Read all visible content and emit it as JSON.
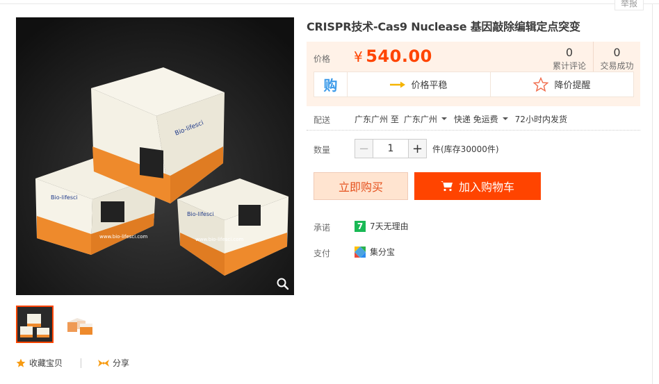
{
  "header": {
    "report_label": "举报"
  },
  "product": {
    "title": "CRISPR技术-Cas9 Nuclease 基因敲除编辑定点突变"
  },
  "gallery": {
    "box_brand": "Bio-lifesci",
    "box_url": "www.bio-lifesci.com",
    "zoom_icon": "magnifier-icon",
    "thumbnail_count": 2,
    "selected_thumbnail": 1
  },
  "actions": {
    "favorite_label": "收藏宝贝",
    "share_label": "分享"
  },
  "price": {
    "label": "价格",
    "currency": "¥",
    "amount": "540.00",
    "color": "#ff4400"
  },
  "stats": [
    {
      "value": "0",
      "label": "累计评论"
    },
    {
      "value": "0",
      "label": "交易成功"
    }
  ],
  "promo": {
    "logo_char": "购",
    "trend_label": "价格平稳",
    "alert_label": "降价提醒"
  },
  "delivery": {
    "label": "配送",
    "from": "广东广州 至",
    "to": "广东广州",
    "method": "快递 免运费",
    "ship_time": "72小时内发货"
  },
  "quantity": {
    "label": "数量",
    "minus": "−",
    "value": "1",
    "plus": "+",
    "stock_text": "件(库存30000件)"
  },
  "buttons": {
    "buy_now": "立即购买",
    "add_to_cart": "加入购物车"
  },
  "promise": {
    "label": "承诺",
    "icon_char": "7",
    "text": "7天无理由"
  },
  "payment": {
    "label": "支付",
    "text": "集分宝"
  }
}
